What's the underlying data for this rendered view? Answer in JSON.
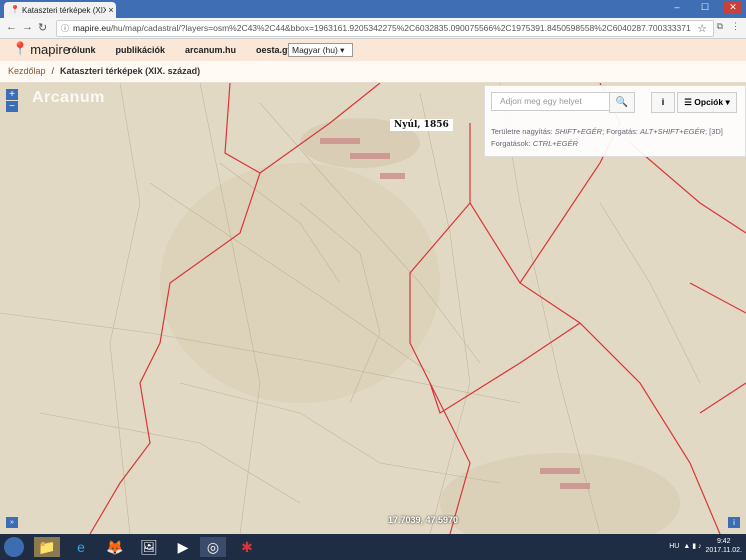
{
  "browser": {
    "tab_title": "Kataszteri térképek (XIX.",
    "tab_close": "×",
    "url_host": "mapire.eu",
    "url_path": "/hu/map/cadastral/?layers=osm%2C43%2C44&bbox=1963161.9205342275%2C6032835.090075566%2C1975391.8450598558%2C6040287.700333371"
  },
  "site": {
    "logo_text": "mapire",
    "menu": [
      "rólunk",
      "publikációk",
      "arcanum.hu",
      "oesta.gv.at"
    ],
    "language": "Magyar (hu) ▾"
  },
  "breadcrumb": {
    "home": "Kezdőlap",
    "separator": "/",
    "current": "Kataszteri térképek (XIX. század)"
  },
  "map": {
    "zoom_in": "+",
    "zoom_out": "−",
    "watermark": "Arcanum",
    "place_label": "Nyúl, 1856",
    "coords": "17.7039, 47.5970",
    "search_placeholder": "Adjon meg egy helyet",
    "options_label": "Opciók ▾",
    "hint_a": "Területre nagyítás: ",
    "hint_a_key": "SHIFT+EGÉR",
    "hint_b": "; Forgatás: ",
    "hint_b_key": "ALT+SHIFT+EGÉR",
    "hint_c": "; [3D] Forgatások: ",
    "hint_c_key": "CTRL+EGÉR"
  },
  "taskbar": {
    "lang": "HU",
    "time": "9:42",
    "date": "2017.11.02."
  },
  "colors": {
    "tabbar": "#3f6eb5",
    "header": "#fbe7d7",
    "boundary": "#d9353a",
    "map_bg": "#e7dfcb"
  }
}
